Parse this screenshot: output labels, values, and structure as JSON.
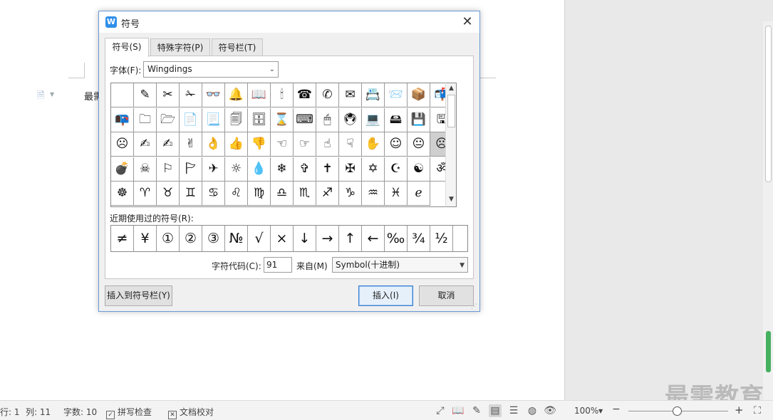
{
  "document": {
    "text_fragment": "最需",
    "file_icon": "document-icon"
  },
  "watermark": "最需教育",
  "dialog": {
    "title": "符号",
    "app_icon": "W",
    "close_icon": "close-icon",
    "tabs": [
      {
        "label": "符号(S)",
        "active": true
      },
      {
        "label": "特殊字符(P)",
        "active": false
      },
      {
        "label": "符号栏(T)",
        "active": false
      }
    ],
    "font_label": "字体(F):",
    "font_value": "Wingdings",
    "recent_label": "近期使用过的符号(R):",
    "code_label": "字符代码(C):",
    "code_value": "91",
    "from_label": "来自(M)",
    "from_value": "Symbol(十进制)",
    "insert_to_bar_button": "插入到符号栏(Y)",
    "insert_button": "插入(I)",
    "cancel_button": "取消",
    "selected_symbol_index": 44,
    "symbols": [
      " ",
      "✎",
      "✂",
      "✁",
      "👓",
      "🔔",
      "📖",
      "🕯",
      "☎",
      "✆",
      "✉",
      "📇",
      "📨",
      "📦",
      "📬",
      "📭",
      "🗀",
      "🗁",
      "📄",
      "📃",
      "🗐",
      "🗄",
      "⌛",
      "⌨",
      "🖱",
      "🖲",
      "💻",
      "🖴",
      "💾",
      "🖫",
      "☹",
      "✍",
      "✍",
      "✌",
      "👌",
      "👍",
      "👎",
      "☜",
      "☞",
      "☝",
      "☟",
      "✋",
      "☺",
      "😐",
      "☹",
      "💣",
      "☠",
      "⚐",
      "🏱",
      "✈",
      "☼",
      "💧",
      "❄",
      "✞",
      "✝",
      "✠",
      "✡",
      "☪",
      "☯",
      "ॐ",
      "☸",
      "♈",
      "♉",
      "♊",
      "♋",
      "♌",
      "♍",
      "♎",
      "♏",
      "♐",
      "♑",
      "♒",
      "♓",
      "ℯ"
    ],
    "recent_symbols": [
      "≠",
      "¥",
      "①",
      "②",
      "③",
      "№",
      "√",
      "×",
      "↓",
      "→",
      "↑",
      "←",
      "‰",
      "¾",
      "½"
    ]
  },
  "statusbar": {
    "row": "行: 1",
    "col": "列: 11",
    "words": "字数: 10",
    "spell_check": "拼写检查",
    "doc_proof": "文档校对",
    "zoom": "100%",
    "zoom_minus": "−",
    "zoom_plus": "+"
  }
}
